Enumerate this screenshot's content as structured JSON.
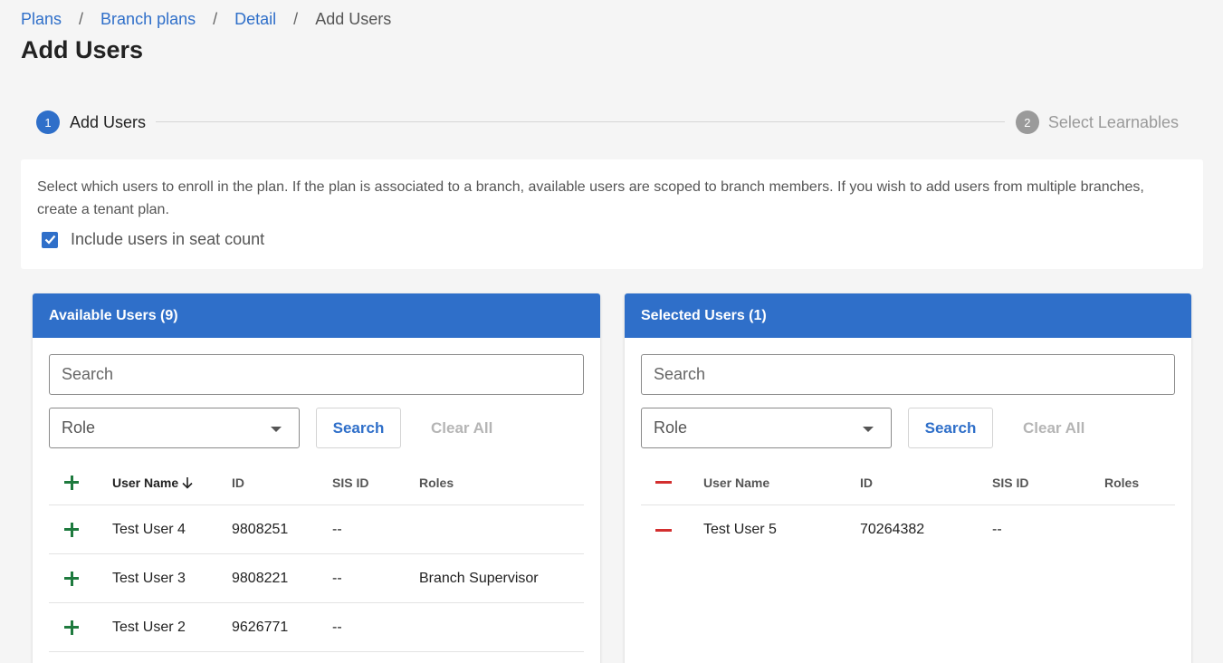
{
  "breadcrumb": {
    "items": [
      "Plans",
      "Branch plans",
      "Detail"
    ],
    "separator": "/",
    "current": "Add Users"
  },
  "page_title": "Add Users",
  "stepper": {
    "steps": [
      {
        "number": "1",
        "label": "Add Users",
        "state": "active"
      },
      {
        "number": "2",
        "label": "Select Learnables",
        "state": "inactive"
      }
    ]
  },
  "info": {
    "text": "Select which users to enroll in the plan. If the plan is associated to a branch, available users are scoped to branch members. If you wish to add users from multiple branches, create a tenant plan.",
    "checkbox_label": "Include users in seat count",
    "checkbox_checked": true
  },
  "available": {
    "title": "Available Users (9)",
    "search_placeholder": "Search",
    "role_placeholder": "Role",
    "search_button": "Search",
    "clear_button": "Clear All",
    "columns": {
      "name": "User Name",
      "id": "ID",
      "sis": "SIS ID",
      "roles": "Roles"
    },
    "rows": [
      {
        "name": "Test User 4",
        "id": "9808251",
        "sis": "--",
        "roles": ""
      },
      {
        "name": "Test User 3",
        "id": "9808221",
        "sis": "--",
        "roles": "Branch Supervisor"
      },
      {
        "name": "Test User 2",
        "id": "9626771",
        "sis": "--",
        "roles": ""
      }
    ]
  },
  "selected": {
    "title": "Selected Users (1)",
    "search_placeholder": "Search",
    "role_placeholder": "Role",
    "search_button": "Search",
    "clear_button": "Clear All",
    "columns": {
      "name": "User Name",
      "id": "ID",
      "sis": "SIS ID",
      "roles": "Roles"
    },
    "rows": [
      {
        "name": "Test User 5",
        "id": "70264382",
        "sis": "--",
        "roles": ""
      }
    ]
  },
  "colors": {
    "primary": "#2f6fc9",
    "add": "#1e7a3e",
    "remove": "#d32f2f",
    "background": "#f5f5f5"
  },
  "icons": {
    "add": "plus-icon",
    "remove": "minus-icon",
    "sort": "arrow-down-icon",
    "dropdown": "caret-down-icon",
    "checkbox": "check-icon"
  }
}
